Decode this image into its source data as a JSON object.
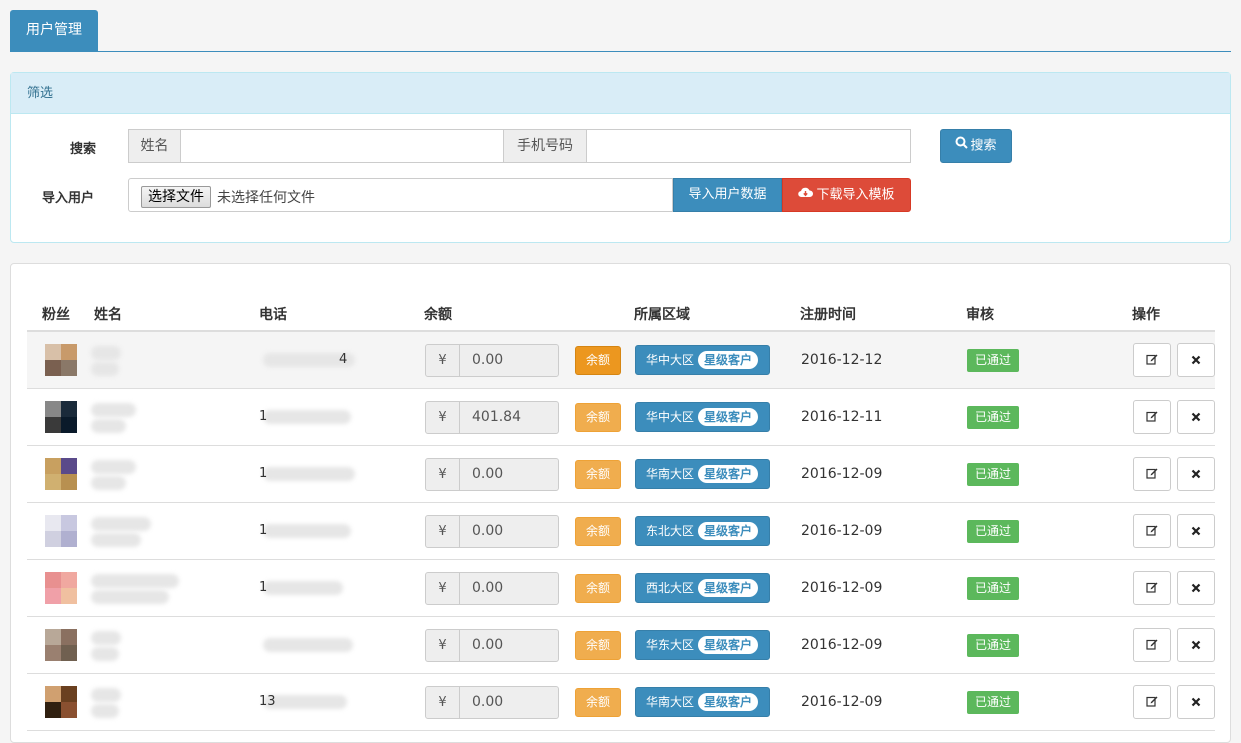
{
  "tab": {
    "label": "用户管理"
  },
  "filter": {
    "heading": "筛选",
    "search_label": "搜索",
    "name_addon": "姓名",
    "name_value": "",
    "phone_addon": "手机号码",
    "phone_value": "",
    "search_button": "搜索",
    "import_label": "导入用户",
    "file_button": "选择文件",
    "file_status": "未选择任何文件",
    "import_button": "导入用户数据",
    "download_button": "下载导入模板"
  },
  "table": {
    "headers": [
      "粉丝",
      "姓名",
      "电话",
      "余额",
      "所属区域",
      "注册时间",
      "审核",
      "操作"
    ],
    "currency": "¥",
    "balance_button": "余额",
    "level_badge": "星级客户",
    "status_label": "已通过",
    "rows": [
      {
        "phone_visible": "4",
        "balance": "0.00",
        "region": "华中大区",
        "date": "2016-12-12",
        "avatar": [
          "#d8c0a8",
          "#c89a6a",
          "#7a6050",
          "#8a7868"
        ]
      },
      {
        "phone_visible": "1",
        "balance": "401.84",
        "region": "华中大区",
        "date": "2016-12-11",
        "avatar": [
          "#888888",
          "#1a2a3a",
          "#3a3a3a",
          "#0a1a2a"
        ]
      },
      {
        "phone_visible": "1",
        "balance": "0.00",
        "region": "华南大区",
        "date": "2016-12-09",
        "avatar": [
          "#c8a060",
          "#5a4a8a",
          "#d0b070",
          "#b89050"
        ]
      },
      {
        "phone_visible": "1",
        "balance": "0.00",
        "region": "东北大区",
        "date": "2016-12-09",
        "avatar": [
          "#e8e8f0",
          "#c8c8e0",
          "#d0d0e0",
          "#b0b0d0"
        ]
      },
      {
        "phone_visible": "1",
        "balance": "0.00",
        "region": "西北大区",
        "date": "2016-12-09",
        "avatar": [
          "#e89090",
          "#f0a8a0",
          "#f0a0a8",
          "#f0c0a0"
        ]
      },
      {
        "phone_visible": "",
        "balance": "0.00",
        "region": "华东大区",
        "date": "2016-12-09",
        "avatar": [
          "#b8a898",
          "#8a7060",
          "#9a8070",
          "#706050"
        ]
      },
      {
        "phone_visible": "13",
        "balance": "0.00",
        "region": "华南大区",
        "date": "2016-12-09",
        "avatar": [
          "#d0a070",
          "#6a4020",
          "#302010",
          "#8a5030"
        ]
      }
    ]
  }
}
